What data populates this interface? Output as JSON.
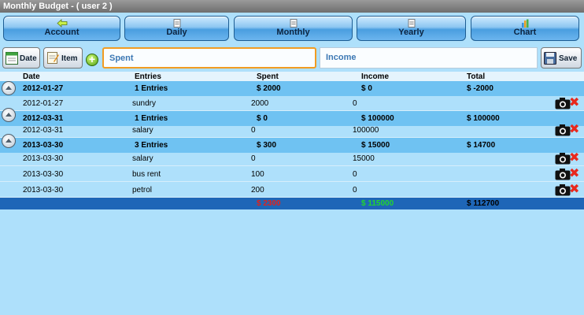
{
  "title": "Monthly Budget - ( user 2 )",
  "nav": [
    {
      "label": "Account",
      "icon": "back-arrow-icon"
    },
    {
      "label": "Daily",
      "icon": "calendar-icon"
    },
    {
      "label": "Monthly",
      "icon": "calendar-icon"
    },
    {
      "label": "Yearly",
      "icon": "calendar-icon"
    },
    {
      "label": "Chart",
      "icon": "bar-chart-icon"
    }
  ],
  "toolbar": {
    "date_label": "Date",
    "item_label": "Item",
    "add_icon": "plus-icon",
    "spent_placeholder": "Spent",
    "income_placeholder": "Income",
    "save_label": "Save"
  },
  "columns": [
    "Date",
    "Entries",
    "Spent",
    "Income",
    "Total"
  ],
  "rows": [
    {
      "type": "group",
      "date": "2012-01-27",
      "entries": "1 Entries",
      "spent": "$ 2000",
      "income": "$ 0",
      "total": "$ -2000"
    },
    {
      "type": "item",
      "date": "2012-01-27",
      "entries": "sundry",
      "spent": "2000",
      "income": "0",
      "total": ""
    },
    {
      "type": "group",
      "date": "2012-03-31",
      "entries": "1 Entries",
      "spent": "$ 0",
      "income": "$ 100000",
      "total": "$ 100000"
    },
    {
      "type": "item",
      "date": "2012-03-31",
      "entries": "salary",
      "spent": "0",
      "income": "100000",
      "total": ""
    },
    {
      "type": "group",
      "date": "2013-03-30",
      "entries": "3 Entries",
      "spent": "$ 300",
      "income": "$ 15000",
      "total": "$ 14700"
    },
    {
      "type": "item",
      "date": "2013-03-30",
      "entries": "salary",
      "spent": "0",
      "income": "15000",
      "total": ""
    },
    {
      "type": "item",
      "date": "2013-03-30",
      "entries": "bus rent",
      "spent": "100",
      "income": "0",
      "total": ""
    },
    {
      "type": "item",
      "date": "2013-03-30",
      "entries": "petrol",
      "spent": "200",
      "income": "0",
      "total": ""
    }
  ],
  "totals": {
    "spent": "$ 2300",
    "income": "$ 115000",
    "total": "$ 112700"
  },
  "colors": {
    "spent_total": "#e3221a",
    "income_total": "#22d52e",
    "total_bar": "#1e66b7"
  }
}
